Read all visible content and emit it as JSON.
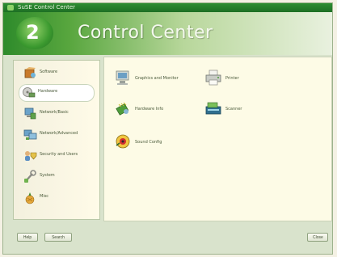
{
  "window": {
    "title": "SuSE Control Center"
  },
  "header": {
    "logo": "2",
    "title": "Control Center"
  },
  "sidebar": {
    "items": [
      {
        "label": "Software",
        "icon": "software-box-icon"
      },
      {
        "label": "Hardware",
        "icon": "hardware-device-icon",
        "selected": true
      },
      {
        "label": "Network/Basic",
        "icon": "network-basic-icon"
      },
      {
        "label": "Network/Advanced",
        "icon": "network-advanced-icon"
      },
      {
        "label": "Security and Users",
        "icon": "security-users-icon"
      },
      {
        "label": "System",
        "icon": "system-tools-icon"
      },
      {
        "label": "Misc",
        "icon": "misc-icon"
      }
    ]
  },
  "content": {
    "items": [
      {
        "label": "Graphics and Monitor",
        "icon": "monitor-icon"
      },
      {
        "label": "Printer",
        "icon": "printer-icon"
      },
      {
        "label": "Hardware Info",
        "icon": "hardware-info-icon"
      },
      {
        "label": "Scanner",
        "icon": "scanner-icon"
      },
      {
        "label": "Sound Config",
        "icon": "sound-icon"
      }
    ]
  },
  "footer": {
    "help_label": "Help",
    "search_label": "Search",
    "close_label": "Close"
  },
  "colors": {
    "accent": "#2e8b2b",
    "content_bg": "#fdfbe6",
    "sidebar_bg": "#f7f3e0"
  }
}
